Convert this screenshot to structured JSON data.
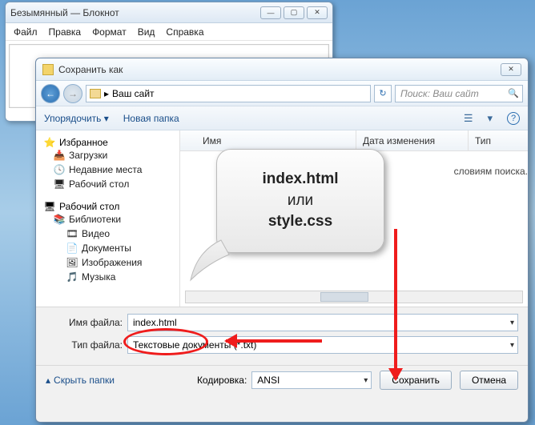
{
  "notepad": {
    "title": "Безымянный — Блокнот",
    "menu": [
      "Файл",
      "Правка",
      "Формат",
      "Вид",
      "Справка"
    ],
    "win_min": "—",
    "win_max": "▢",
    "win_close": "✕"
  },
  "dialog": {
    "title": "Сохранить как",
    "win_close": "✕",
    "nav_back": "←",
    "nav_fwd": "→",
    "path_root": "▸",
    "path_label": "Ваш сайт",
    "refresh": "↻",
    "search_placeholder": "Поиск: Ваш сайт",
    "organize": "Упорядочить ▾",
    "new_folder": "Новая папка",
    "view_ic": "☰",
    "opt_ic": "▾",
    "help_ic": "?",
    "cols": {
      "name": "Имя",
      "date": "Дата изменения",
      "type": "Тип"
    },
    "empty_msg": "словиям поиска.",
    "sidebar": {
      "favorites": "Избранное",
      "fav_items": [
        "Загрузки",
        "Недавние места",
        "Рабочий стол"
      ],
      "desktop": "Рабочий стол",
      "libraries": "Библиотеки",
      "lib_items": [
        "Видео",
        "Документы",
        "Изображения",
        "Музыка"
      ]
    },
    "file_label": "Имя файла:",
    "file_value": "index.html",
    "type_label": "Тип файла:",
    "type_value": "Текстовые документы (*.txt)",
    "hide": "Скрыть папки",
    "enc_label": "Кодировка:",
    "enc_value": "ANSI",
    "save": "Сохранить",
    "cancel": "Отмена"
  },
  "callout": {
    "l1": "index.html",
    "l2": "или",
    "l3": "style.css"
  }
}
